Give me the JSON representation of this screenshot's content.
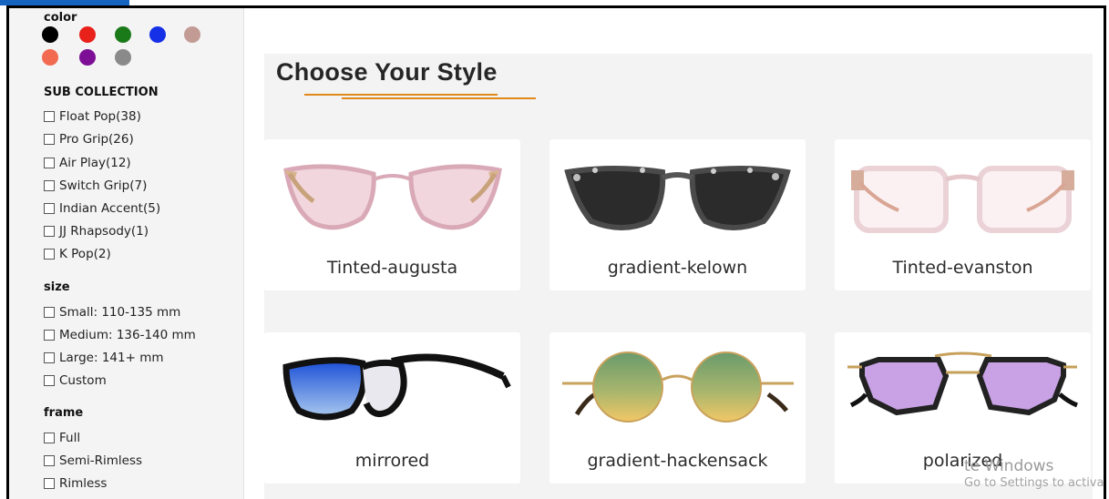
{
  "filters": {
    "color_title": "color",
    "colors": [
      "#000000",
      "#e8211a",
      "#1a7a1a",
      "#1530e6",
      "#c29b95",
      "#f26a4f",
      "#7d0f96",
      "#8a8a8a"
    ],
    "sub_collection": {
      "title": "SUB COLLECTION",
      "items": [
        "Float Pop(38)",
        "Pro Grip(26)",
        "Air Play(12)",
        "Switch Grip(7)",
        "Indian Accent(5)",
        "JJ Rhapsody(1)",
        "K Pop(2)"
      ]
    },
    "size": {
      "title": "size",
      "items": [
        "Small: 110-135 mm",
        "Medium: 136-140 mm",
        "Large: 141+ mm",
        "Custom"
      ]
    },
    "frame": {
      "title": "frame",
      "items": [
        "Full",
        "Semi-Rimless",
        "Rimless"
      ]
    }
  },
  "main": {
    "heading": "Choose Your Style",
    "accent_color": "#e0891a",
    "cards": [
      {
        "label": "Tinted-augusta",
        "icon": "cat-eye-glasses-icon"
      },
      {
        "label": "gradient-kelown",
        "icon": "tortoise-sunglasses-icon"
      },
      {
        "label": "Tinted-evanston",
        "icon": "square-clear-glasses-icon"
      },
      {
        "label": "mirrored",
        "icon": "blue-mirrored-sunglasses-icon"
      },
      {
        "label": "gradient-hackensack",
        "icon": "round-gradient-sunglasses-icon"
      },
      {
        "label": "polarized",
        "icon": "purple-aviator-sunglasses-icon"
      }
    ]
  },
  "watermark": {
    "line1": "te Windows",
    "line2": "Go to Settings to activat"
  }
}
